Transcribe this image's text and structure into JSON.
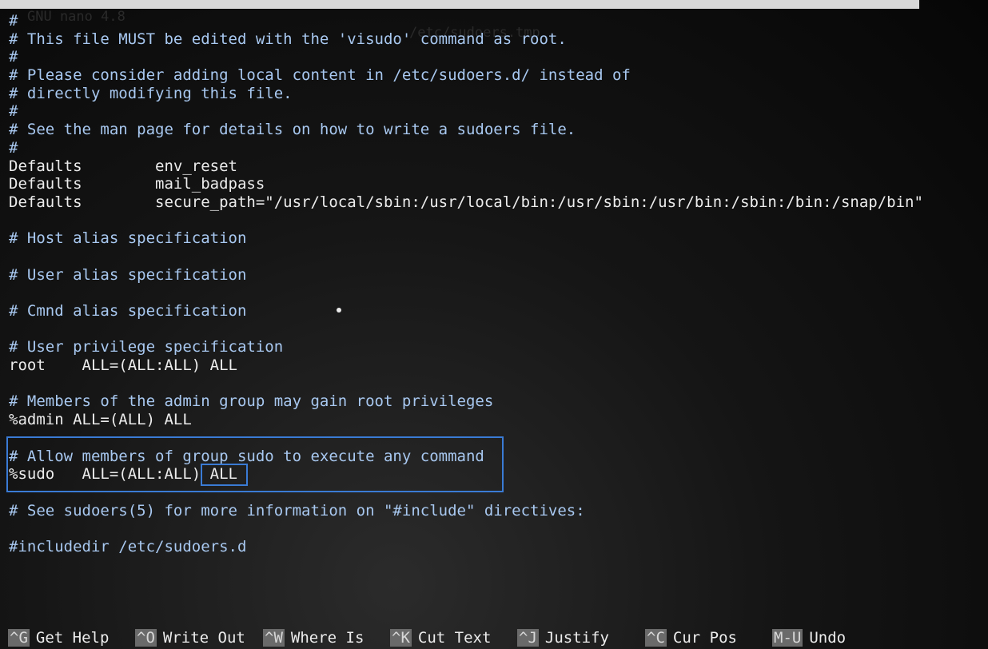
{
  "titlebar": {
    "version": "GNU nano 4.8",
    "filename": "/etc/sudoers.tmp"
  },
  "editor": {
    "lines": [
      "#",
      "# This file MUST be edited with the 'visudo' command as root.",
      "#",
      "# Please consider adding local content in /etc/sudoers.d/ instead of",
      "# directly modifying this file.",
      "#",
      "# See the man page for details on how to write a sudoers file.",
      "#",
      "Defaults        env_reset",
      "Defaults        mail_badpass",
      "Defaults        secure_path=\"/usr/local/sbin:/usr/local/bin:/usr/sbin:/usr/bin:/sbin:/bin:/snap/bin\"",
      "",
      "# Host alias specification",
      "",
      "# User alias specification",
      "",
      "# Cmnd alias specification",
      "",
      "# User privilege specification",
      "root    ALL=(ALL:ALL) ALL",
      "",
      "# Members of the admin group may gain root privileges",
      "%admin ALL=(ALL) ALL",
      "",
      "# Allow members of group sudo to execute any command",
      "%sudo   ALL=(ALL:ALL) ALL",
      "",
      "# See sudoers(5) for more information on \"#include\" directives:",
      "",
      "#includedir /etc/sudoers.d"
    ]
  },
  "shortcuts": [
    {
      "key": "^G",
      "label": "Get Help"
    },
    {
      "key": "^O",
      "label": "Write Out"
    },
    {
      "key": "^W",
      "label": "Where Is"
    },
    {
      "key": "^K",
      "label": "Cut Text"
    },
    {
      "key": "^J",
      "label": "Justify"
    },
    {
      "key": "^C",
      "label": "Cur Pos"
    },
    {
      "key": "M-U",
      "label": "Undo"
    }
  ],
  "colors": {
    "comment": "#a8c8f0",
    "highlight_border": "#3a7bd5",
    "titlebar_bg": "#d8d8d8"
  }
}
